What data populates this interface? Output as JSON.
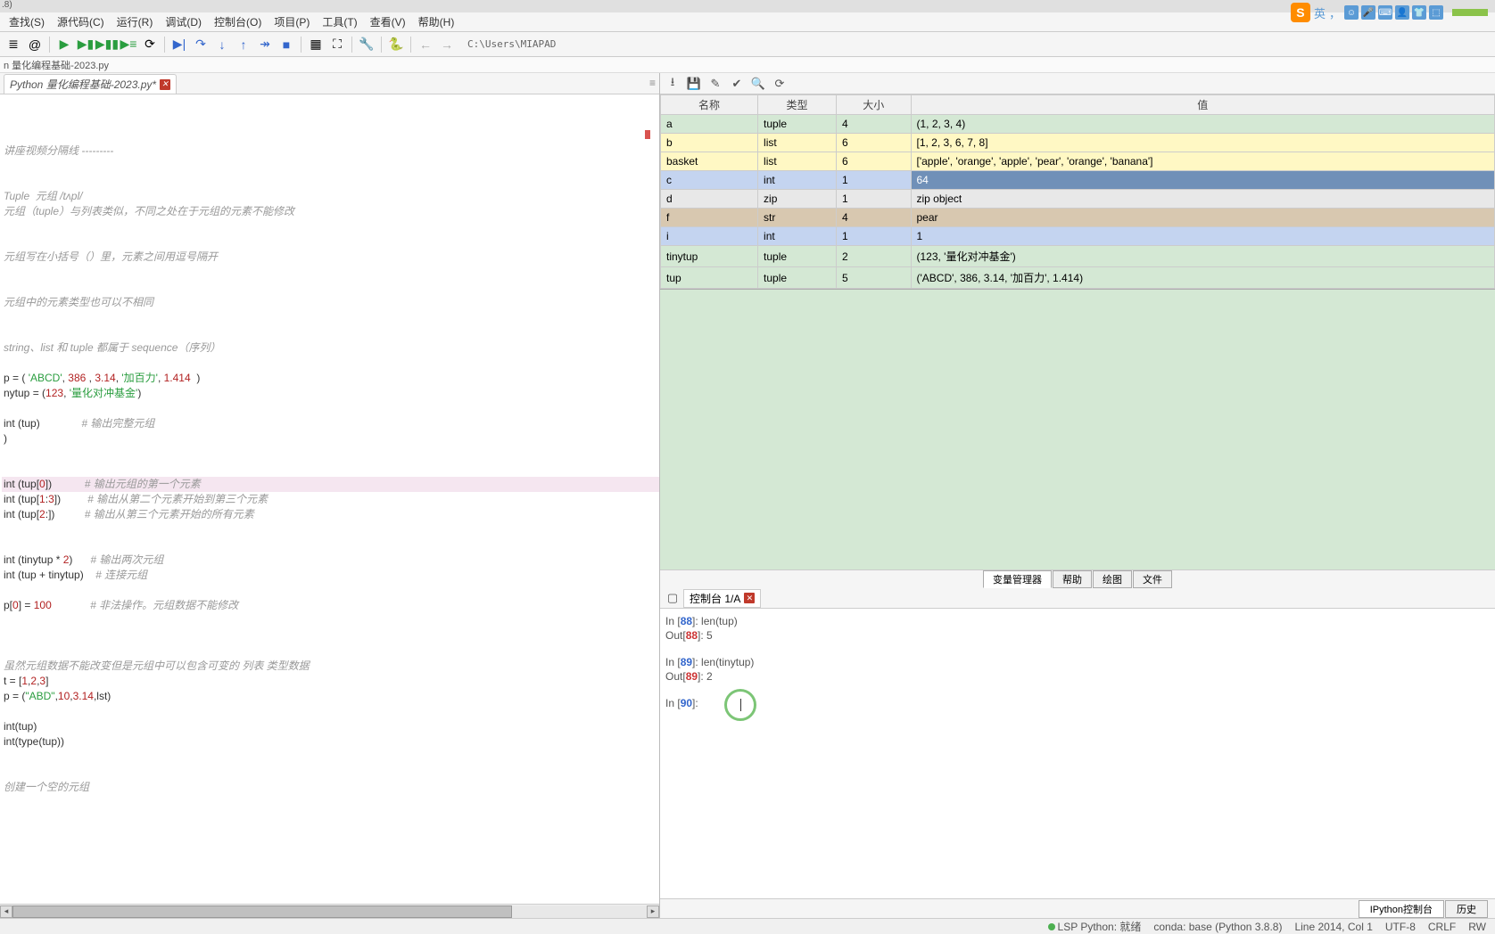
{
  "titlebar": ".8)",
  "top_badge": {
    "label": "英",
    "text": "，",
    "icons": [
      "☺",
      "🎤",
      "📋",
      "👤",
      "👕",
      "⬚"
    ]
  },
  "menu": [
    "查找(S)",
    "源代码(C)",
    "运行(R)",
    "调试(D)",
    "控制台(O)",
    "项目(P)",
    "工具(T)",
    "查看(V)",
    "帮助(H)"
  ],
  "toolbar_path": "C:\\Users\\MIAPAD",
  "breadcrumb": "n 量化编程基础-2023.py",
  "file_tab": "Python 量化编程基础-2023.py*",
  "code_lines": [
    {
      "t": "讲座视频分隔线 ---------",
      "cls": "code-comment"
    },
    {
      "t": ""
    },
    {
      "t": ""
    },
    {
      "t": "Tuple  元组 /tʌpl/",
      "cls": "code-comment"
    },
    {
      "t": "元组（tuple）与列表类似，不同之处在于元组的元素不能修改",
      "cls": "code-comment"
    },
    {
      "t": ""
    },
    {
      "t": ""
    },
    {
      "t": "元组写在小括号（）里，元素之间用逗号隔开",
      "cls": "code-comment"
    },
    {
      "t": ""
    },
    {
      "t": ""
    },
    {
      "t": "元组中的元素类型也可以不相同",
      "cls": "code-comment"
    },
    {
      "t": ""
    },
    {
      "t": ""
    },
    {
      "t": "string、list 和 tuple 都属于 sequence（序列）",
      "cls": "code-comment"
    },
    {
      "t": ""
    },
    {
      "t": "p = ( 'ABCD', 386 , 3.14, '加百力', 1.414  )",
      "parts": [
        [
          "p = ( ",
          ""
        ],
        [
          "'ABCD'",
          "code-str"
        ],
        [
          ", ",
          ""
        ],
        [
          "386",
          "code-num"
        ],
        [
          " , ",
          ""
        ],
        [
          "3.14",
          "code-num"
        ],
        [
          ", ",
          ""
        ],
        [
          "'加百力'",
          "code-str"
        ],
        [
          ", ",
          ""
        ],
        [
          "1.414",
          "code-num"
        ],
        [
          "  )",
          ""
        ]
      ]
    },
    {
      "t": "nytup = (123, '量化对冲基金')",
      "parts": [
        [
          "nytup = (",
          ""
        ],
        [
          "123",
          "code-num"
        ],
        [
          ", ",
          ""
        ],
        [
          "'量化对冲基金'",
          "code-str"
        ],
        [
          ")",
          ""
        ]
      ]
    },
    {
      "t": ""
    },
    {
      "t": "int (tup)              # 输出完整元组",
      "parts": [
        [
          "int",
          ""
        ],
        [
          " (tup)              ",
          ""
        ],
        [
          "# 输出完整元组",
          "code-comment"
        ]
      ]
    },
    {
      "t": ")"
    },
    {
      "t": ""
    },
    {
      "t": ""
    },
    {
      "t": "int (tup[0])           # 输出元组的第一个元素",
      "highlight": true,
      "parts": [
        [
          "int",
          ""
        ],
        [
          " (tup[",
          ""
        ],
        [
          "0",
          "code-num"
        ],
        [
          "])           ",
          ""
        ],
        [
          "# 输出元组的第一个元素",
          "code-comment"
        ]
      ]
    },
    {
      "t": "int (tup[1:3])         # 输出从第二个元素开始到第三个元素",
      "parts": [
        [
          "int",
          ""
        ],
        [
          " (tup[",
          ""
        ],
        [
          "1",
          "code-num"
        ],
        [
          ":",
          ""
        ],
        [
          "3",
          "code-num"
        ],
        [
          "])         ",
          ""
        ],
        [
          "# 输出从第二个元素开始到第三个元素",
          "code-comment"
        ]
      ]
    },
    {
      "t": "int (tup[2:])          # 输出从第三个元素开始的所有元素",
      "parts": [
        [
          "int",
          ""
        ],
        [
          " (tup[",
          ""
        ],
        [
          "2",
          "code-num"
        ],
        [
          ":])          ",
          ""
        ],
        [
          "# 输出从第三个元素开始的所有元素",
          "code-comment"
        ]
      ]
    },
    {
      "t": ""
    },
    {
      "t": ""
    },
    {
      "t": "int (tinytup * 2)      # 输出两次元组",
      "parts": [
        [
          "int",
          ""
        ],
        [
          " (tinytup * ",
          ""
        ],
        [
          "2",
          "code-num"
        ],
        [
          ")      ",
          ""
        ],
        [
          "# 输出两次元组",
          "code-comment"
        ]
      ]
    },
    {
      "t": "int (tup + tinytup)    # 连接元组",
      "parts": [
        [
          "int",
          ""
        ],
        [
          " (tup + tinytup)    ",
          ""
        ],
        [
          "# 连接元组",
          "code-comment"
        ]
      ]
    },
    {
      "t": ""
    },
    {
      "t": "p[0] = 100             # 非法操作。元组数据不能修改",
      "parts": [
        [
          "p[",
          ""
        ],
        [
          "0",
          "code-num"
        ],
        [
          "] = ",
          ""
        ],
        [
          "100",
          "code-num"
        ],
        [
          "             ",
          ""
        ],
        [
          "# 非法操作。元组数据不能修改",
          "code-comment"
        ]
      ]
    },
    {
      "t": ""
    },
    {
      "t": ""
    },
    {
      "t": ""
    },
    {
      "t": "虽然元组数据不能改变但是元组中可以包含可变的 列表 类型数据",
      "cls": "code-comment"
    },
    {
      "t": "t = [1,2,3]",
      "parts": [
        [
          "t = [",
          ""
        ],
        [
          "1",
          "code-num"
        ],
        [
          ",",
          ""
        ],
        [
          "2",
          "code-num"
        ],
        [
          ",",
          ""
        ],
        [
          "3",
          "code-num"
        ],
        [
          "]",
          ""
        ]
      ]
    },
    {
      "t": "p = (\"ABD\",10,3.14,lst)",
      "parts": [
        [
          "p = (",
          ""
        ],
        [
          "\"ABD\"",
          "code-str"
        ],
        [
          ",",
          ""
        ],
        [
          "10",
          "code-num"
        ],
        [
          ",",
          ""
        ],
        [
          "3.14",
          "code-num"
        ],
        [
          ",lst)",
          ""
        ]
      ]
    },
    {
      "t": ""
    },
    {
      "t": "int(tup)"
    },
    {
      "t": "int(type(tup))"
    },
    {
      "t": ""
    },
    {
      "t": ""
    },
    {
      "t": "创建一个空的元组",
      "cls": "code-comment"
    }
  ],
  "var_header": {
    "name": "名称",
    "type": "类型",
    "size": "大小",
    "value": "值"
  },
  "vars": [
    {
      "name": "a",
      "type": "tuple",
      "size": "4",
      "value": "(1, 2, 3, 4)",
      "cls": "row-a"
    },
    {
      "name": "b",
      "type": "list",
      "size": "6",
      "value": "[1, 2, 3, 6, 7, 8]",
      "cls": "row-b"
    },
    {
      "name": "basket",
      "type": "list",
      "size": "6",
      "value": "['apple', 'orange', 'apple', 'pear', 'orange', 'banana']",
      "cls": "row-basket"
    },
    {
      "name": "c",
      "type": "int",
      "size": "1",
      "value": "64",
      "cls": "row-c",
      "selected": true
    },
    {
      "name": "d",
      "type": "zip",
      "size": "1",
      "value": "zip object",
      "cls": "row-d"
    },
    {
      "name": "f",
      "type": "str",
      "size": "4",
      "value": "pear",
      "cls": "row-f"
    },
    {
      "name": "i",
      "type": "int",
      "size": "1",
      "value": "1",
      "cls": "row-i"
    },
    {
      "name": "tinytup",
      "type": "tuple",
      "size": "2",
      "value": "(123, '量化对冲基金')",
      "cls": "row-tiny"
    },
    {
      "name": "tup",
      "type": "tuple",
      "size": "5",
      "value": "('ABCD', 386, 3.14, '加百力', 1.414)",
      "cls": "row-tup"
    }
  ],
  "var_tabs": {
    "vm": "变量管理器",
    "help": "帮助",
    "plot": "绘图",
    "file": "文件"
  },
  "console_tab": "控制台 1/A",
  "console": {
    "in88": "In [",
    "in88n": "88",
    "in88e": "]: len(tup)",
    "out88": "Out[",
    "out88n": "88",
    "out88e": "]: 5",
    "in89": "In [",
    "in89n": "89",
    "in89e": "]: len(tinytup)",
    "out89": "Out[",
    "out89n": "89",
    "out89e": "]: 2",
    "in90": "In [",
    "in90n": "90",
    "in90e": "]: "
  },
  "bottom_tabs": {
    "ipython": "IPython控制台",
    "history": "历史"
  },
  "status": {
    "lsp": "LSP Python: 就绪",
    "conda": "conda: base (Python 3.8.8)",
    "pos": "Line 2014, Col 1",
    "enc": "UTF-8",
    "eol": "CRLF",
    "rw": "RW"
  }
}
